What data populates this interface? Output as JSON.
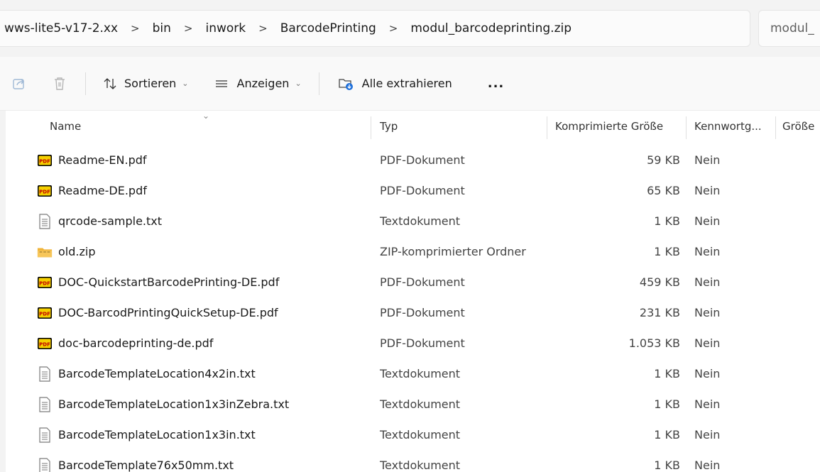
{
  "address": {
    "crumbs": [
      "wws-lite5-v17-2.xx",
      "bin",
      "inwork",
      "BarcodePrinting",
      "modul_barcodeprinting.zip"
    ],
    "separator": ">",
    "search_text": "modul_"
  },
  "toolbar": {
    "sort_label": "Sortieren",
    "view_label": "Anzeigen",
    "extract_label": "Alle extrahieren",
    "more_label": "..."
  },
  "columns": {
    "name": "Name",
    "type": "Typ",
    "compressed_size": "Komprimierte Größe",
    "password": "Kennwortg...",
    "size": "Größe"
  },
  "files": [
    {
      "name": "Readme-EN.pdf",
      "type": "PDF-Dokument",
      "size": "59 KB",
      "password": "Nein",
      "icon": "pdf-icon"
    },
    {
      "name": "Readme-DE.pdf",
      "type": "PDF-Dokument",
      "size": "65 KB",
      "password": "Nein",
      "icon": "pdf-icon"
    },
    {
      "name": "qrcode-sample.txt",
      "type": "Textdokument",
      "size": "1 KB",
      "password": "Nein",
      "icon": "text-file-icon"
    },
    {
      "name": "old.zip",
      "type": "ZIP-komprimierter Ordner",
      "size": "1 KB",
      "password": "Nein",
      "icon": "zip-folder-icon"
    },
    {
      "name": "DOC-QuickstartBarcodePrinting-DE.pdf",
      "type": "PDF-Dokument",
      "size": "459 KB",
      "password": "Nein",
      "icon": "pdf-icon"
    },
    {
      "name": "DOC-BarcodPrintingQuickSetup-DE.pdf",
      "type": "PDF-Dokument",
      "size": "231 KB",
      "password": "Nein",
      "icon": "pdf-icon"
    },
    {
      "name": "doc-barcodeprinting-de.pdf",
      "type": "PDF-Dokument",
      "size": "1.053 KB",
      "password": "Nein",
      "icon": "pdf-icon"
    },
    {
      "name": "BarcodeTemplateLocation4x2in.txt",
      "type": "Textdokument",
      "size": "1 KB",
      "password": "Nein",
      "icon": "text-file-icon"
    },
    {
      "name": "BarcodeTemplateLocation1x3inZebra.txt",
      "type": "Textdokument",
      "size": "1 KB",
      "password": "Nein",
      "icon": "text-file-icon"
    },
    {
      "name": "BarcodeTemplateLocation1x3in.txt",
      "type": "Textdokument",
      "size": "1 KB",
      "password": "Nein",
      "icon": "text-file-icon"
    },
    {
      "name": "BarcodeTemplate76x50mm.txt",
      "type": "Textdokument",
      "size": "1 KB",
      "password": "Nein",
      "icon": "text-file-icon"
    }
  ],
  "colors": {
    "pdf_badge": "#f5d000",
    "pdf_text": "#c00000",
    "zip_folder": "#f0b43a"
  }
}
